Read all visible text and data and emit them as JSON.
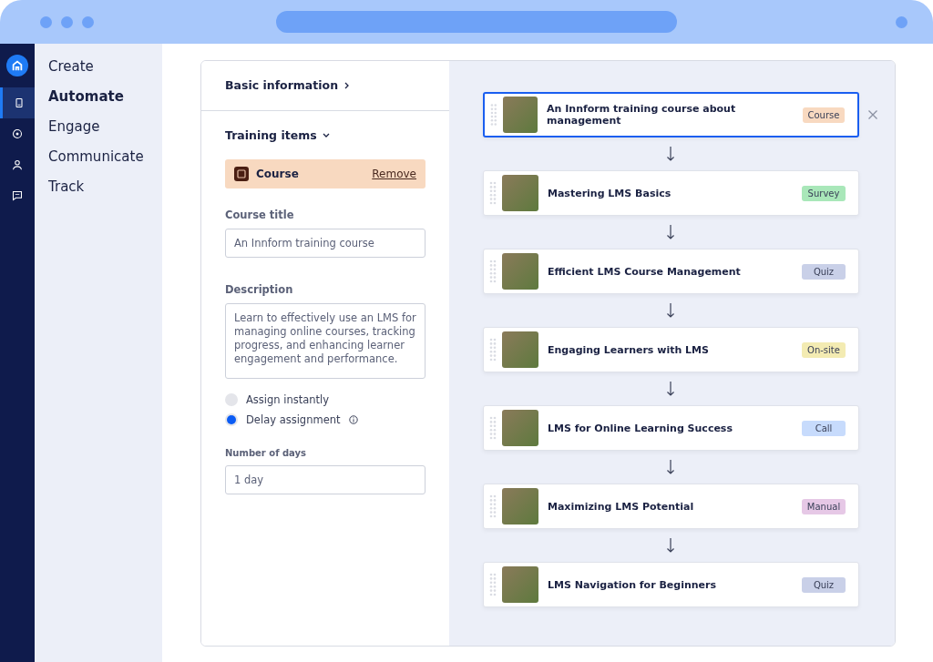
{
  "rail": [
    {
      "kind": "home",
      "selected": false
    },
    {
      "kind": "book",
      "selected": true
    },
    {
      "kind": "ball",
      "selected": false
    },
    {
      "kind": "person",
      "selected": false
    },
    {
      "kind": "chat",
      "selected": false
    }
  ],
  "nav": [
    {
      "label": "Create",
      "selected": false
    },
    {
      "label": "Automate",
      "selected": true
    },
    {
      "label": "Engage",
      "selected": false
    },
    {
      "label": "Communicate",
      "selected": false
    },
    {
      "label": "Track",
      "selected": false
    }
  ],
  "form": {
    "basic_info": {
      "label": "Basic information",
      "expanded": false
    },
    "training_items": {
      "label": "Training items",
      "expanded": true
    },
    "item": {
      "label": "Course",
      "action": "Remove"
    },
    "course_title": {
      "label": "Course title",
      "value": "An Innform training course"
    },
    "description": {
      "label": "Description",
      "value": "Learn to effectively use an LMS for managing online courses, tracking progress, and enhancing learner engagement and performance."
    },
    "assignment": [
      {
        "label": "Assign instantly",
        "selected": false,
        "info": false
      },
      {
        "label": "Delay assignment",
        "selected": true,
        "info": true
      }
    ],
    "days": {
      "label": "Number of days",
      "value": "1 day"
    }
  },
  "steps": [
    {
      "title": "An Innform training course about management",
      "tag": "Course",
      "color": "#f8d9c0",
      "selected": true
    },
    {
      "title": "Mastering LMS Basics",
      "tag": "Survey",
      "color": "#a9e7b9",
      "selected": false
    },
    {
      "title": "Efficient LMS Course Management",
      "tag": "Quiz",
      "color": "#c9d0e8",
      "selected": false
    },
    {
      "title": "Engaging Learners with LMS",
      "tag": "On-site",
      "color": "#f3ebb2",
      "selected": false
    },
    {
      "title": "LMS for Online Learning Success",
      "tag": "Call",
      "color": "#c7dbfc",
      "selected": false
    },
    {
      "title": "Maximizing LMS Potential",
      "tag": "Manual",
      "color": "#e6c8e6",
      "selected": false
    },
    {
      "title": "LMS Navigation for Beginners",
      "tag": "Quiz",
      "color": "#c9d0e8",
      "selected": false
    }
  ]
}
